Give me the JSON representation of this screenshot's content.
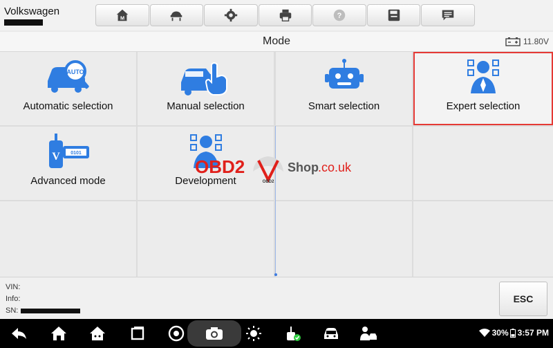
{
  "header": {
    "brand": "Volkswagen",
    "toolbar": [
      {
        "name": "home-icon"
      },
      {
        "name": "vehicle-lift-icon"
      },
      {
        "name": "gear-icon"
      },
      {
        "name": "printer-icon"
      },
      {
        "name": "help-icon"
      },
      {
        "name": "save-icon"
      },
      {
        "name": "chat-icon"
      }
    ]
  },
  "titlebar": {
    "title": "Mode",
    "voltage": "11.80V"
  },
  "modes": [
    {
      "label": "Automatic selection",
      "icon": "car-auto-search-icon"
    },
    {
      "label": "Manual selection",
      "icon": "car-hand-tap-icon"
    },
    {
      "label": "Smart selection",
      "icon": "robot-icon"
    },
    {
      "label": "Expert selection",
      "icon": "expert-person-icon",
      "selected": true
    },
    {
      "label": "Advanced mode",
      "icon": "vci-device-icon"
    },
    {
      "label": "Development",
      "icon": "developer-person-icon"
    }
  ],
  "watermark": {
    "left": "OBD2",
    "right": "Shop",
    "suffix": ".co.uk",
    "badge": "OBD2"
  },
  "info": {
    "vin_label": "VIN:",
    "info_label": "Info:",
    "sn_label": "SN:",
    "esc": "ESC"
  },
  "statusbar": {
    "battery": "30%",
    "time": "3:57 PM"
  },
  "colors": {
    "accent": "#2f7de1",
    "selected_border": "#e53935",
    "watermark_red": "#e0201b"
  }
}
